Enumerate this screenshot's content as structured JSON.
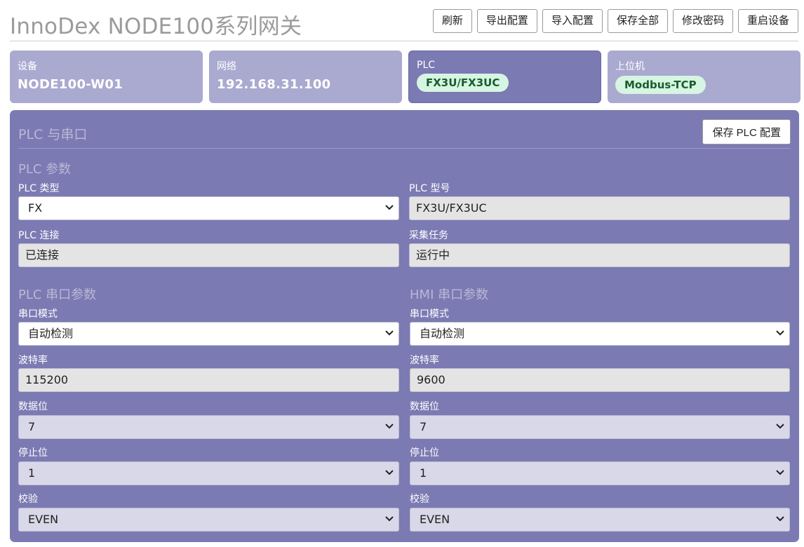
{
  "header": {
    "title": "InnoDex NODE100系列网关",
    "buttons": [
      "刷新",
      "导出配置",
      "导入配置",
      "保存全部",
      "修改密码",
      "重启设备"
    ]
  },
  "cards": {
    "device": {
      "label": "设备",
      "value": "NODE100-W01"
    },
    "network": {
      "label": "网络",
      "value": "192.168.31.100"
    },
    "plc": {
      "label": "PLC",
      "value": "FX3U/FX3UC"
    },
    "host": {
      "label": "上位机",
      "value": "Modbus-TCP"
    }
  },
  "panel": {
    "title": "PLC 与串口",
    "save_button": "保存 PLC 配置",
    "plc_params": {
      "title": "PLC 参数",
      "type_label": "PLC 类型",
      "type_value": "FX",
      "model_label": "PLC 型号",
      "model_value": "FX3U/FX3UC",
      "conn_label": "PLC 连接",
      "conn_value": "已连接",
      "task_label": "采集任务",
      "task_value": "运行中"
    },
    "plc_serial": {
      "title": "PLC 串口参数",
      "mode_label": "串口模式",
      "mode_value": "自动检测",
      "baud_label": "波特率",
      "baud_value": "115200",
      "databits_label": "数据位",
      "databits_value": "7",
      "stopbits_label": "停止位",
      "stopbits_value": "1",
      "parity_label": "校验",
      "parity_value": "EVEN"
    },
    "hmi_serial": {
      "title": "HMI 串口参数",
      "mode_label": "串口模式",
      "mode_value": "自动检测",
      "baud_label": "波特率",
      "baud_value": "9600",
      "databits_label": "数据位",
      "databits_value": "7",
      "stopbits_label": "停止位",
      "stopbits_value": "1",
      "parity_label": "校验",
      "parity_value": "EVEN"
    }
  },
  "colors": {
    "card": "#aaa9d0",
    "card_active": "#7b7ab3",
    "panel": "#7b7ab3",
    "pill_bg": "#d6f5e2",
    "pill_text": "#1a5c2d"
  },
  "icons": {
    "select_arrow": "chevron-down-icon"
  }
}
